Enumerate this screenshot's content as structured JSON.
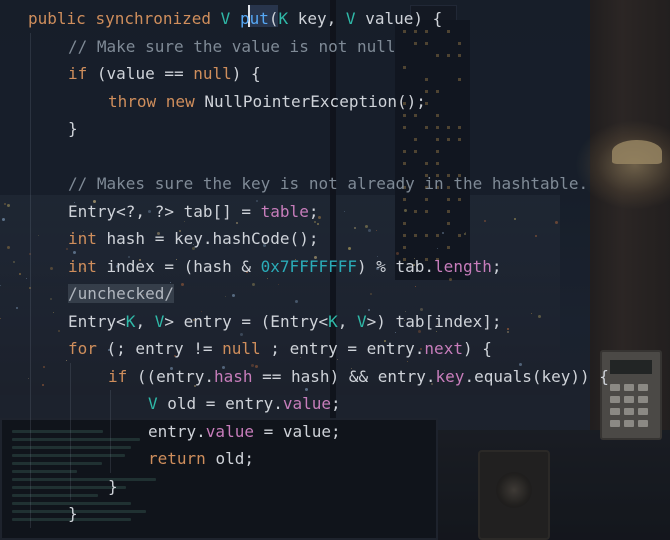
{
  "editor": {
    "lines": [
      {
        "indent": 0,
        "tokens": [
          [
            "kw",
            "public "
          ],
          [
            "kw",
            "synchronized "
          ],
          [
            "type",
            "V "
          ],
          [
            "fn",
            "put"
          ],
          [
            "plain",
            "("
          ],
          [
            "type",
            "K "
          ],
          [
            "plain",
            "key, "
          ],
          [
            "type",
            "V "
          ],
          [
            "plain",
            "value) {"
          ]
        ]
      },
      {
        "indent": 1,
        "tokens": [
          [
            "comment",
            "// Make sure the value is not null"
          ]
        ]
      },
      {
        "indent": 1,
        "tokens": [
          [
            "kw",
            "if "
          ],
          [
            "plain",
            "(value == "
          ],
          [
            "kw",
            "null"
          ],
          [
            "plain",
            ") {"
          ]
        ]
      },
      {
        "indent": 2,
        "tokens": [
          [
            "kw",
            "throw "
          ],
          [
            "kw",
            "new "
          ],
          [
            "plain",
            "NullPointerException();"
          ]
        ]
      },
      {
        "indent": 1,
        "tokens": [
          [
            "plain",
            "}"
          ]
        ]
      },
      {
        "indent": 0,
        "tokens": []
      },
      {
        "indent": 1,
        "tokens": [
          [
            "comment",
            "// Makes sure the key is not already in the hashtable."
          ]
        ]
      },
      {
        "indent": 1,
        "tokens": [
          [
            "plain",
            "Entry<?, ?> tab[] = "
          ],
          [
            "field",
            "table"
          ],
          [
            "plain",
            ";"
          ]
        ]
      },
      {
        "indent": 1,
        "tokens": [
          [
            "kw",
            "int "
          ],
          [
            "plain",
            "hash = key.hashCode();"
          ]
        ]
      },
      {
        "indent": 1,
        "tokens": [
          [
            "kw",
            "int "
          ],
          [
            "plain",
            "index = (hash & "
          ],
          [
            "num",
            "0x7FFFFFFF"
          ],
          [
            "plain",
            ") % tab."
          ],
          [
            "field",
            "length"
          ],
          [
            "plain",
            ";"
          ]
        ]
      },
      {
        "indent": 1,
        "tokens": [
          [
            "annot",
            "/unchecked/"
          ]
        ]
      },
      {
        "indent": 1,
        "tokens": [
          [
            "plain",
            "Entry<"
          ],
          [
            "type",
            "K"
          ],
          [
            "plain",
            ", "
          ],
          [
            "type",
            "V"
          ],
          [
            "plain",
            "> entry = (Entry<"
          ],
          [
            "type",
            "K"
          ],
          [
            "plain",
            ", "
          ],
          [
            "type",
            "V"
          ],
          [
            "plain",
            ">) tab[index];"
          ]
        ]
      },
      {
        "indent": 1,
        "tokens": [
          [
            "kw",
            "for "
          ],
          [
            "plain",
            "(; entry != "
          ],
          [
            "kw",
            "null "
          ],
          [
            "plain",
            "; entry = entry."
          ],
          [
            "field",
            "next"
          ],
          [
            "plain",
            ") {"
          ]
        ]
      },
      {
        "indent": 2,
        "tokens": [
          [
            "kw",
            "if "
          ],
          [
            "plain",
            "((entry."
          ],
          [
            "field",
            "hash"
          ],
          [
            "plain",
            " == hash) && entry."
          ],
          [
            "field",
            "key"
          ],
          [
            "plain",
            ".equals(key)) {"
          ]
        ]
      },
      {
        "indent": 3,
        "tokens": [
          [
            "type",
            "V "
          ],
          [
            "plain",
            "old = entry."
          ],
          [
            "field",
            "value"
          ],
          [
            "plain",
            ";"
          ]
        ]
      },
      {
        "indent": 3,
        "tokens": [
          [
            "plain",
            "entry."
          ],
          [
            "field",
            "value"
          ],
          [
            "plain",
            " = value;"
          ]
        ]
      },
      {
        "indent": 3,
        "tokens": [
          [
            "kw",
            "return "
          ],
          [
            "plain",
            "old;"
          ]
        ]
      },
      {
        "indent": 2,
        "tokens": [
          [
            "plain",
            "}"
          ]
        ]
      },
      {
        "indent": 1,
        "tokens": [
          [
            "plain",
            "}"
          ]
        ]
      }
    ]
  },
  "colors": {
    "keyword": "#cf8e5c",
    "type_param": "#2fb9a8",
    "method": "#56a8f5",
    "text": "#cfd3d9",
    "comment": "#7f8a96",
    "field": "#c77dbb",
    "number": "#2aacb8"
  }
}
